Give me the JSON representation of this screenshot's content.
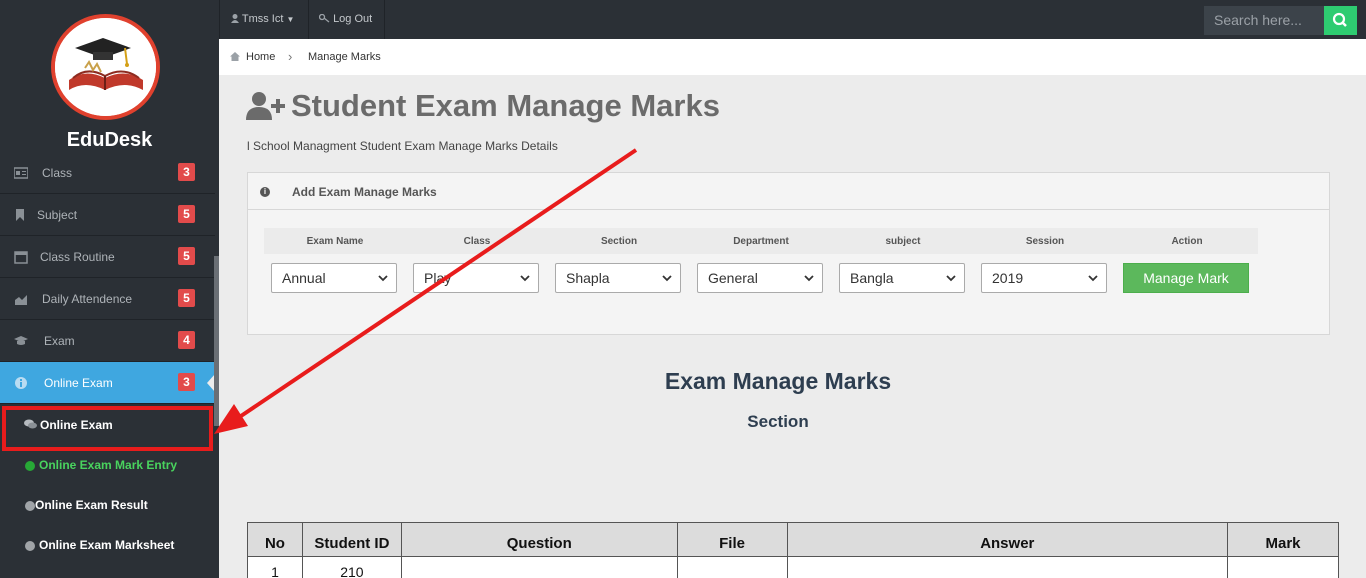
{
  "app": {
    "brand": "EduDesk"
  },
  "topbar": {
    "user": "Tmss Ict",
    "logout": "Log Out",
    "search_placeholder": "Search here..."
  },
  "breadcrumb": {
    "home": "Home",
    "current": "Manage Marks"
  },
  "page": {
    "title": "Student Exam Manage Marks",
    "subtitle": "l School Managment Student Exam Manage Marks Details"
  },
  "sidebar": {
    "items": [
      {
        "label": "Class",
        "badge": "3",
        "icon": "id-card-icon"
      },
      {
        "label": "Subject",
        "badge": "5",
        "icon": "bookmark-icon"
      },
      {
        "label": "Class Routine",
        "badge": "5",
        "icon": "calendar-icon"
      },
      {
        "label": "Daily Attendence",
        "badge": "5",
        "icon": "area-chart-icon"
      },
      {
        "label": "Exam",
        "badge": "4",
        "icon": "graduation-cap-icon"
      },
      {
        "label": "Online Exam",
        "badge": "3",
        "icon": "info-icon",
        "active": true
      }
    ],
    "submenu": [
      {
        "label": "Online Exam",
        "icon": "comments-icon"
      },
      {
        "label": "Online Exam Mark Entry"
      },
      {
        "label": "Online Exam Result"
      },
      {
        "label": "Online Exam Marksheet"
      }
    ]
  },
  "panel": {
    "title": "Add Exam Manage Marks",
    "headers": [
      "Exam Name",
      "Class",
      "Section",
      "Department",
      "subject",
      "Session",
      "Action"
    ],
    "values": [
      "Annual",
      "Play",
      "Shapla",
      "General",
      "Bangla",
      "2019"
    ],
    "button": "Manage Mark"
  },
  "results": {
    "title": "Exam Manage Marks",
    "subtitle": "Section"
  },
  "table": {
    "headers": [
      "No",
      "Student ID",
      "Question",
      "File",
      "Answer",
      "Mark"
    ],
    "rows": [
      [
        "1",
        "210",
        "",
        "",
        "",
        ""
      ]
    ]
  },
  "colors": {
    "sidebar": "#2b3036",
    "active": "#3fa7e0",
    "badge": "#e24b4b",
    "button": "#5cb85c",
    "search_btn": "#2ecc71",
    "annotation": "#e81c1c"
  }
}
